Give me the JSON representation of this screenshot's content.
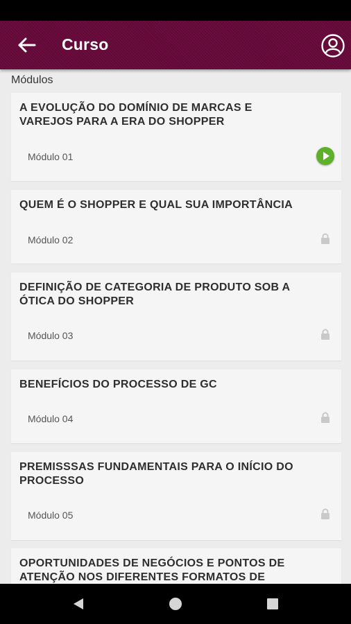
{
  "app_bar": {
    "title": "Curso",
    "back_icon": "arrow-left-icon",
    "profile_icon": "user-circle-icon",
    "color": "#66093a"
  },
  "section": {
    "label": "Módulos"
  },
  "modules": [
    {
      "title": "A EVOLUÇÃO DO DOMÍNIO DE MARCAS E VAREJOS PARA A ERA DO SHOPPER",
      "subtitle": "Módulo 01",
      "status": "play"
    },
    {
      "title": "QUEM É O SHOPPER E QUAL SUA IMPORTÂNCIA",
      "subtitle": "Módulo 02",
      "status": "locked"
    },
    {
      "title": "DEFINIÇÃO DE CATEGORIA DE PRODUTO SOB A ÓTICA DO SHOPPER",
      "subtitle": "Módulo 03",
      "status": "locked"
    },
    {
      "title": "BENEFÍCIOS DO PROCESSO DE GC",
      "subtitle": "Módulo 04",
      "status": "locked"
    },
    {
      "title": "PREMISSSAS FUNDAMENTAIS PARA O INÍCIO DO PROCESSO",
      "subtitle": "Módulo 05",
      "status": "locked"
    },
    {
      "title": "OPORTUNIDADES DE NEGÓCIOS E PONTOS DE ATENÇÃO NOS DIFERENTES FORMATOS DE",
      "subtitle": "",
      "status": ""
    }
  ],
  "colors": {
    "play": "#5db02a",
    "lock": "#c9c9c9"
  },
  "nav": {
    "back_icon": "triangle-back-icon",
    "home_icon": "circle-home-icon",
    "recents_icon": "square-recents-icon"
  }
}
